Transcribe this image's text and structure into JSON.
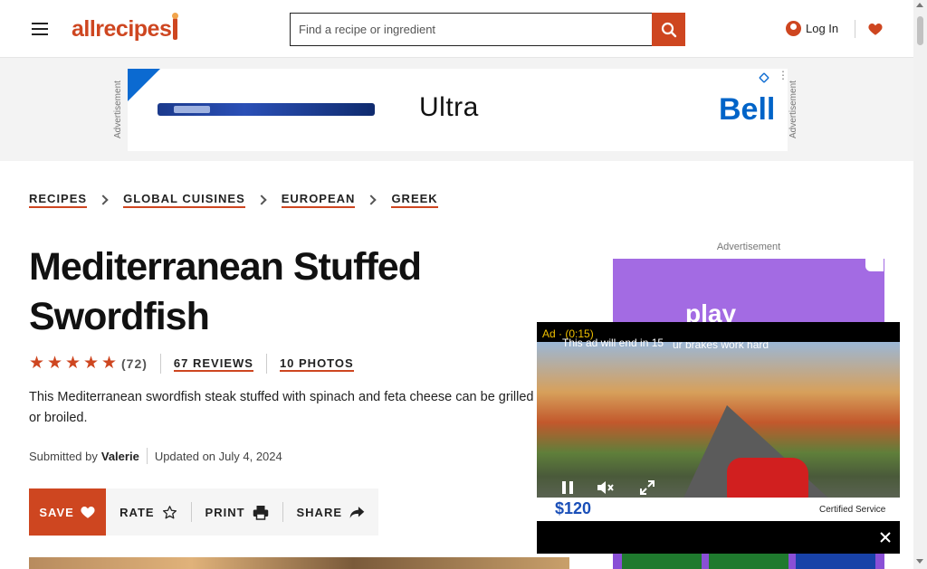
{
  "header": {
    "logo_text": "allrecipes",
    "search": {
      "placeholder": "Find a recipe or ingredient",
      "value": ""
    },
    "login_label": "Log In",
    "brand_color": "#ce4620"
  },
  "top_ad": {
    "label": "Advertisement",
    "headline": "Ultra",
    "brand": "Bell"
  },
  "breadcrumb": [
    "RECIPES",
    "GLOBAL CUISINES",
    "EUROPEAN",
    "GREEK"
  ],
  "recipe": {
    "title": "Mediterranean Stuffed Swordfish",
    "rating_count": "(72)",
    "stars": 5,
    "reviews_label": "67 REVIEWS",
    "photos_label": "10 PHOTOS",
    "description": "This Mediterranean swordfish steak stuffed with spinach and feta cheese can be grilled or broiled.",
    "submitted_prefix": "Submitted by",
    "author": "Valerie",
    "updated": "Updated on July 4, 2024"
  },
  "actions": {
    "save": "SAVE",
    "rate": "RATE",
    "print": "PRINT",
    "share": "SHARE"
  },
  "side_ad": {
    "label": "Advertisement",
    "brand_text": "play"
  },
  "video_ad": {
    "ad_timer": "Ad · (0:15)",
    "end_notice": "This ad will end in 15",
    "overlay_text": "ur brakes work hard",
    "price": "$120",
    "cert": "Certified Service"
  },
  "icons": {
    "menu": "hamburger-icon",
    "search": "search-icon",
    "user": "user-icon",
    "favorite": "heart-icon",
    "star": "star-icon",
    "print": "printer-icon",
    "share": "share-arrow-icon",
    "pause": "pause-icon",
    "mute": "mute-icon",
    "fullscreen": "expand-icon",
    "close": "close-icon"
  }
}
